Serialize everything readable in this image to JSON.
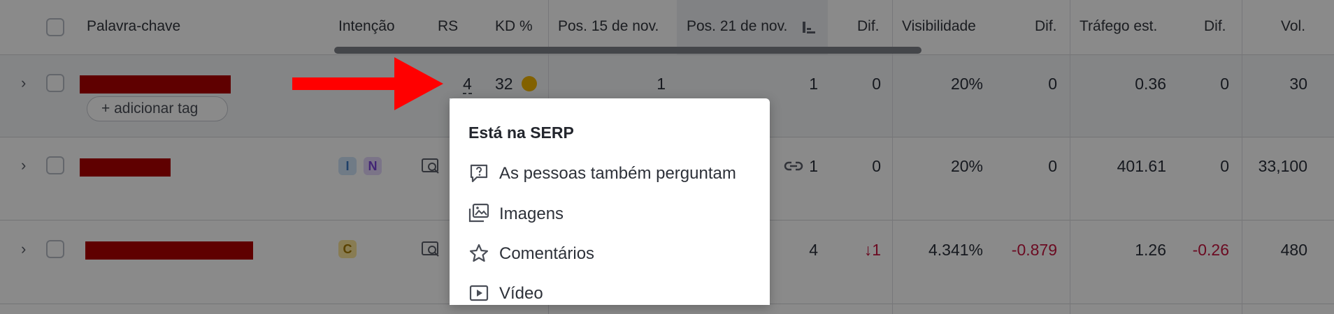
{
  "header": {
    "keyword": "Palavra-chave",
    "intent": "Intenção",
    "rs": "RS",
    "kd": "KD %",
    "pos_nov15": "Pos. 15 de nov.",
    "pos_nov21": "Pos. 21 de nov.",
    "dif1": "Dif.",
    "visibility": "Visibilidade",
    "dif2": "Dif.",
    "traffic": "Tráfego est.",
    "dif3": "Dif.",
    "vol": "Vol."
  },
  "rows": [
    {
      "rs": "4",
      "kd": "32",
      "pos15": "1",
      "pos21": "1",
      "dif": "0",
      "visibility": "20%",
      "vis_dif": "0",
      "traffic": "0.36",
      "traffic_dif": "0",
      "vol": "30",
      "add_tag": "adicionar tag"
    },
    {
      "intents": [
        "I",
        "N"
      ],
      "pos21": "1",
      "dif": "0",
      "visibility": "20%",
      "vis_dif": "0",
      "traffic": "401.61",
      "traffic_dif": "0",
      "vol": "33,100"
    },
    {
      "intents": [
        "C"
      ],
      "pos21": "4",
      "dif": "↓1",
      "visibility": "4.341%",
      "vis_dif": "-0.879",
      "traffic": "1.26",
      "traffic_dif": "-0.26",
      "vol": "480"
    }
  ],
  "popup": {
    "title": "Está na SERP",
    "items": [
      {
        "label": "As pessoas também perguntam",
        "icon": "question-bubble-icon"
      },
      {
        "label": "Imagens",
        "icon": "images-icon"
      },
      {
        "label": "Comentários",
        "icon": "star-icon"
      },
      {
        "label": "Vídeo",
        "icon": "video-play-icon"
      }
    ]
  },
  "colors": {
    "kd_dot": "#f0b400",
    "negative": "#c6163f",
    "arrow": "#ff0000",
    "redaction": "#b00000"
  }
}
